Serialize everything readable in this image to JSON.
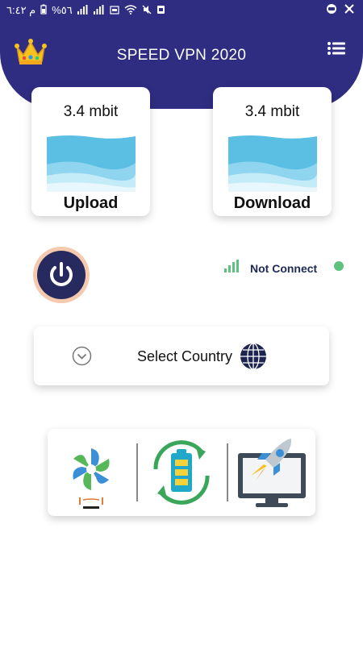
{
  "status_bar": {
    "time": "م ٦:٤٢",
    "battery": "%٥٦"
  },
  "app": {
    "title": "SPEED VPN 2020"
  },
  "upload": {
    "rate": "3.4 mbit",
    "label": "Upload"
  },
  "download": {
    "rate": "3.4 mbit",
    "label": "Download"
  },
  "connection": {
    "status": "Not Connect"
  },
  "country": {
    "label": "Select Country"
  },
  "icons": [
    "crown-icon",
    "menu-icon",
    "power-icon",
    "signal-icon",
    "chevron-down-icon",
    "globe-icon",
    "fan-icon",
    "battery-recycle-icon",
    "rocket-monitor-icon"
  ],
  "colors": {
    "header": "#2e2d82",
    "status_dot": "#5fc27e",
    "power_ring": "#f5c9ad",
    "power_bg": "#262a5e"
  }
}
